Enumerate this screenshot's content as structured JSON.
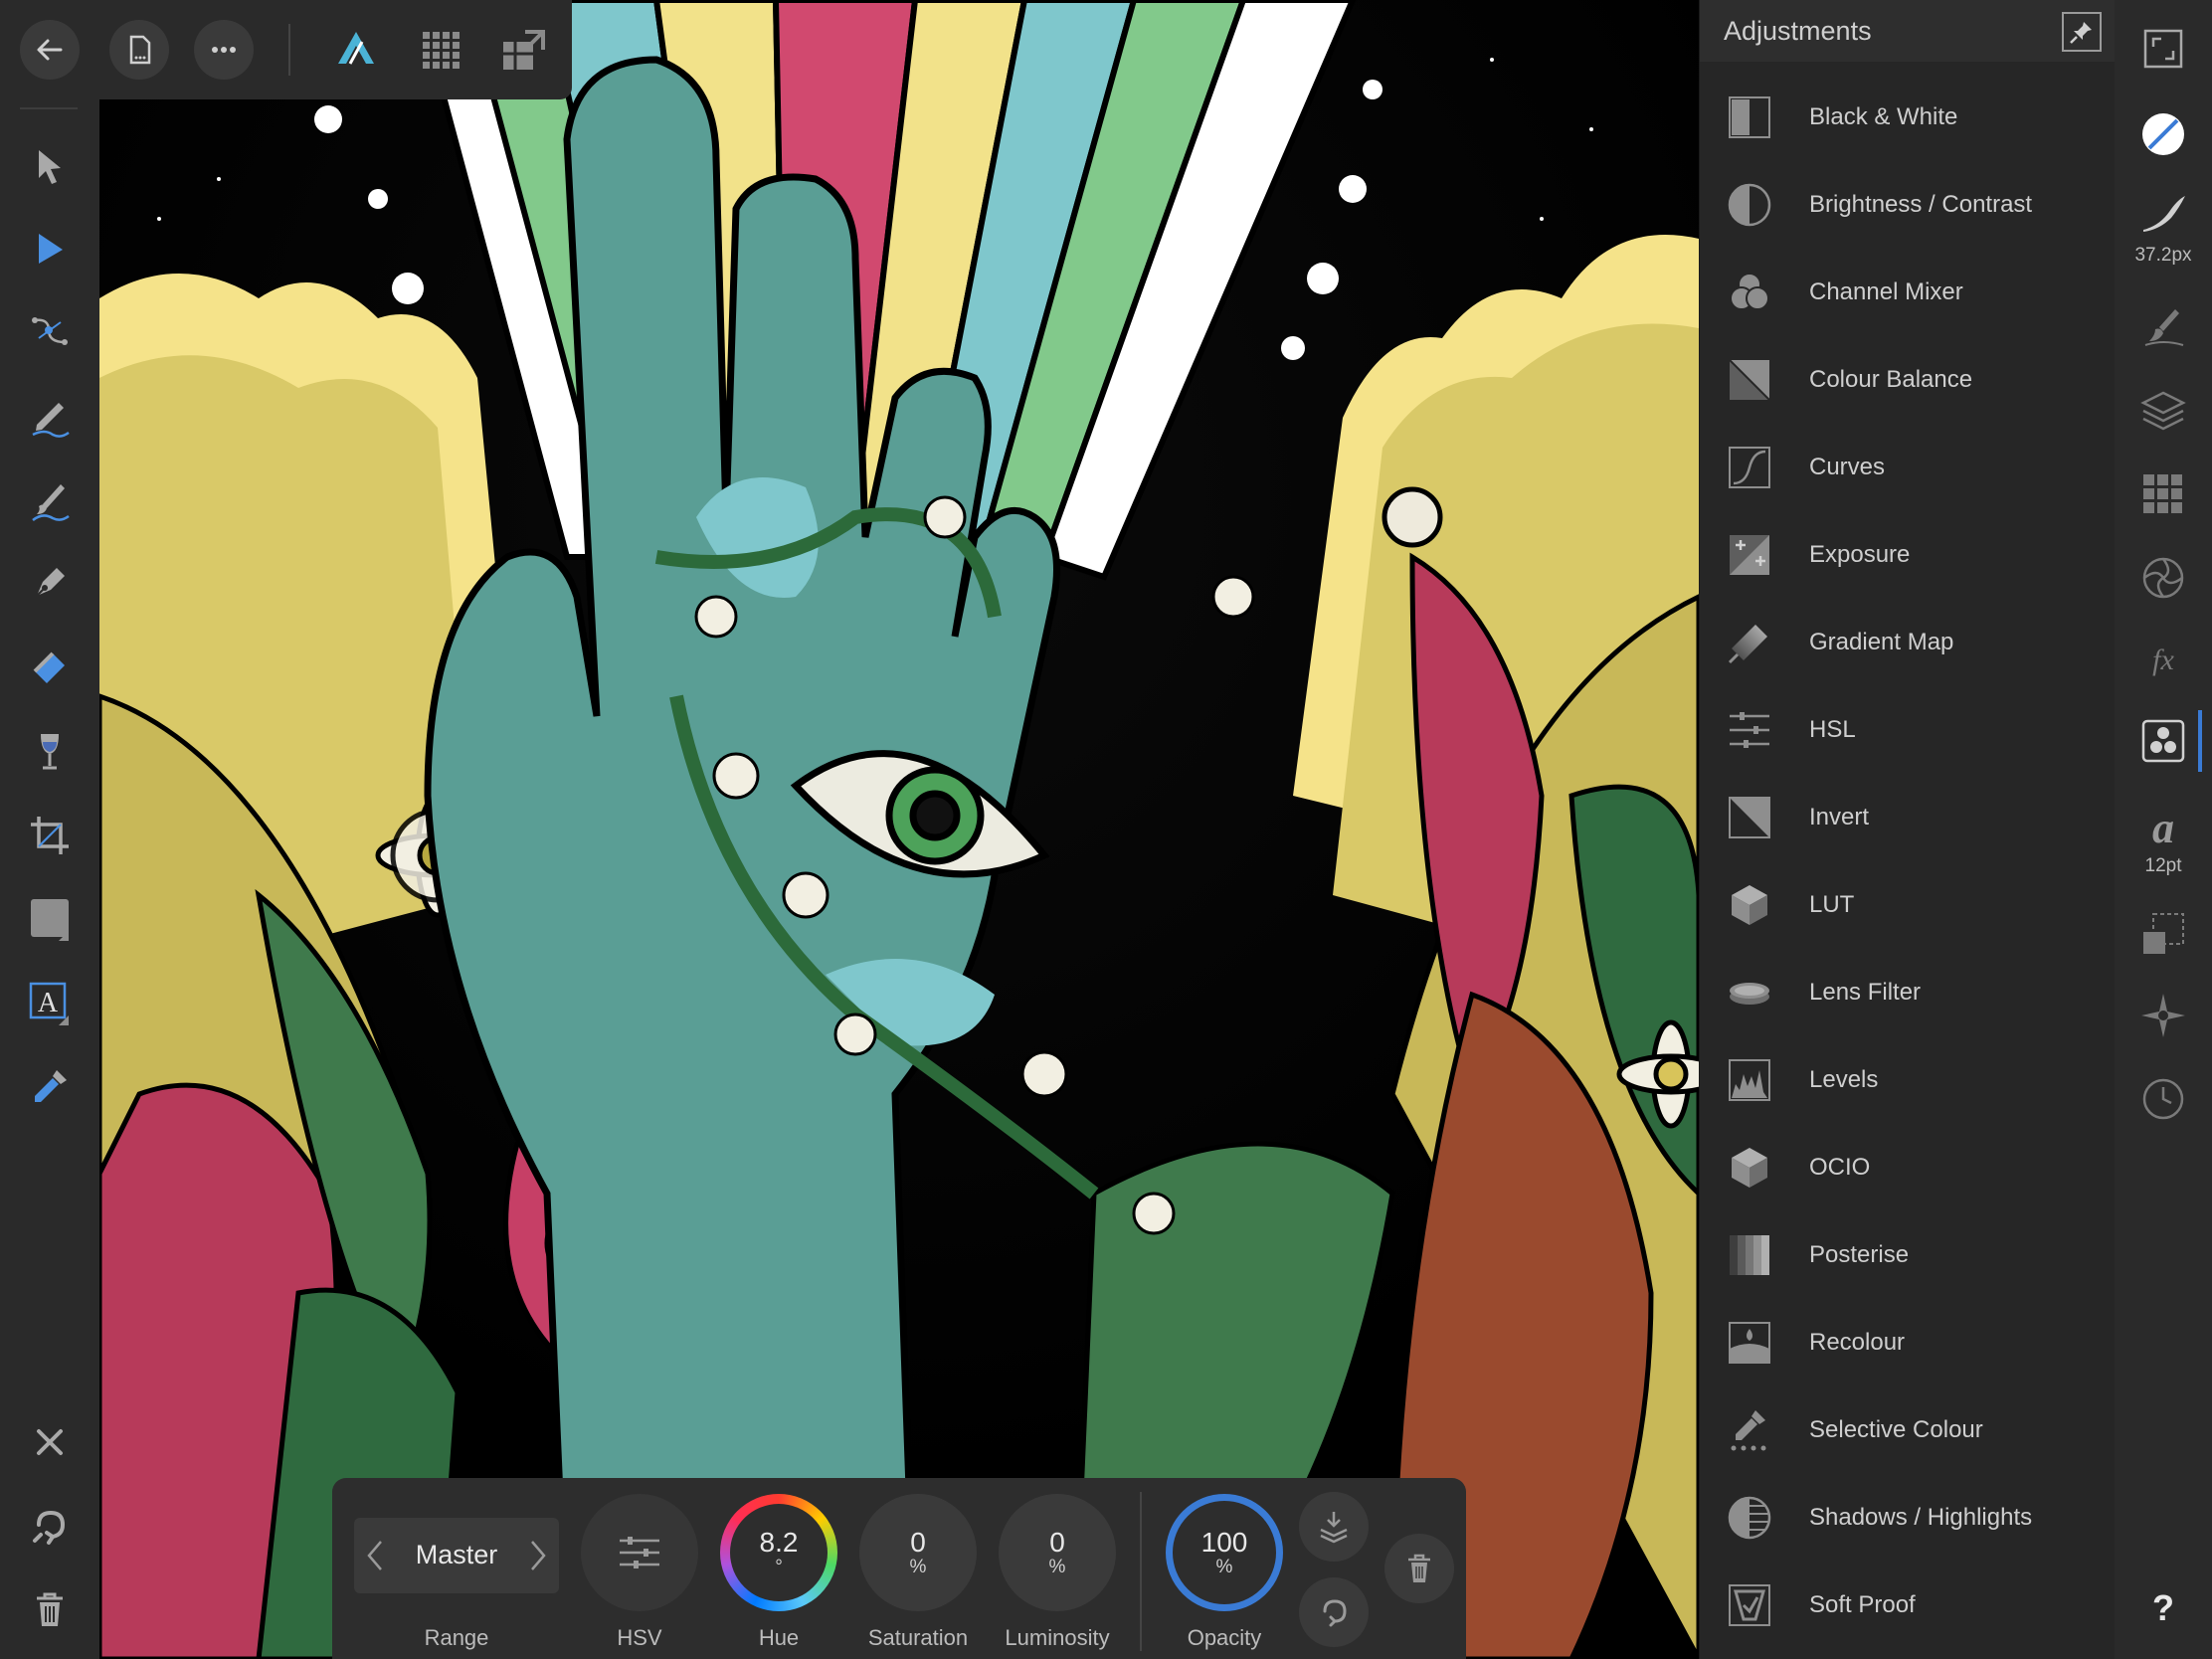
{
  "top_bar": {
    "back_icon": "back-arrow-icon",
    "document_icon": "document-icon",
    "more_icon": "more-dots-icon",
    "personas": [
      "photo-persona-icon",
      "pixel-persona-icon",
      "export-persona-icon"
    ]
  },
  "tools": [
    "move-tool-icon",
    "selection-tool-icon",
    "node-tool-icon",
    "pencil-tool-icon",
    "brush-tool-icon",
    "pen-tool-icon",
    "fill-tool-icon",
    "glass-tool-icon",
    "crop-tool-icon",
    "shape-tool-icon",
    "text-tool-icon",
    "color-picker-tool-icon"
  ],
  "bottom_left": [
    "cancel-icon",
    "undo-icon",
    "trash-icon"
  ],
  "adjustments": {
    "title": "Adjustments",
    "items": [
      {
        "label": "Black & White",
        "icon": "black-white-icon"
      },
      {
        "label": "Brightness / Contrast",
        "icon": "brightness-contrast-icon"
      },
      {
        "label": "Channel Mixer",
        "icon": "channel-mixer-icon"
      },
      {
        "label": "Colour Balance",
        "icon": "colour-balance-icon"
      },
      {
        "label": "Curves",
        "icon": "curves-icon"
      },
      {
        "label": "Exposure",
        "icon": "exposure-icon"
      },
      {
        "label": "Gradient Map",
        "icon": "gradient-map-icon"
      },
      {
        "label": "HSL",
        "icon": "hsl-icon"
      },
      {
        "label": "Invert",
        "icon": "invert-icon"
      },
      {
        "label": "LUT",
        "icon": "lut-icon"
      },
      {
        "label": "Lens Filter",
        "icon": "lens-filter-icon"
      },
      {
        "label": "Levels",
        "icon": "levels-icon"
      },
      {
        "label": "OCIO",
        "icon": "ocio-icon"
      },
      {
        "label": "Posterise",
        "icon": "posterise-icon"
      },
      {
        "label": "Recolour",
        "icon": "recolour-icon"
      },
      {
        "label": "Selective Colour",
        "icon": "selective-colour-icon"
      },
      {
        "label": "Shadows / Highlights",
        "icon": "shadows-highlights-icon"
      },
      {
        "label": "Soft Proof",
        "icon": "soft-proof-icon"
      }
    ]
  },
  "studio": {
    "brush_size": "37.2px",
    "font_size": "12pt",
    "help": "?"
  },
  "context_bar": {
    "range": {
      "value": "Master",
      "label": "Range"
    },
    "hsv": {
      "label": "HSV"
    },
    "hue": {
      "value": "8.2",
      "unit": "°",
      "label": "Hue"
    },
    "saturation": {
      "value": "0",
      "unit": "%",
      "label": "Saturation"
    },
    "luminosity": {
      "value": "0",
      "unit": "%",
      "label": "Luminosity"
    },
    "opacity": {
      "value": "100",
      "unit": "%",
      "label": "Opacity"
    }
  },
  "colors": {
    "accent": "#3a7bd5",
    "panel": "#262626",
    "toolbar": "#2a2a2a"
  }
}
